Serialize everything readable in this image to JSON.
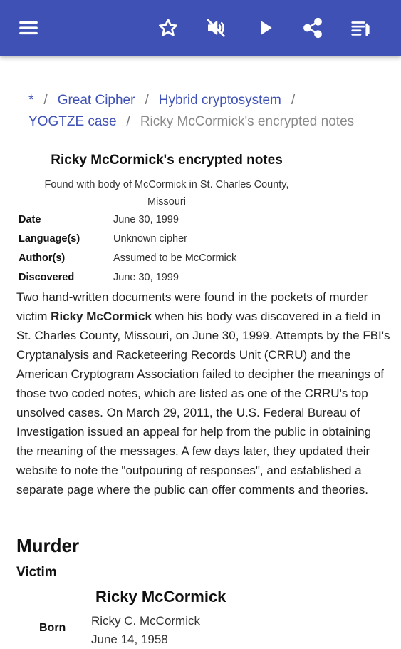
{
  "toolbar": {
    "menu_icon": "hamburger-menu-icon",
    "star_icon": "star-outline-icon",
    "mute_icon": "volume-off-icon",
    "play_icon": "play-icon",
    "share_icon": "share-icon",
    "toc_icon": "playlist-icon",
    "color": "#3f51b5"
  },
  "breadcrumb": {
    "items": [
      "*",
      "Great Cipher",
      "Hybrid cryptosystem",
      "YOGTZE case"
    ],
    "current": "Ricky McCormick's encrypted notes",
    "separator": "/"
  },
  "infobox": {
    "title": "Ricky McCormick's encrypted notes",
    "caption_line1": "Found with body of McCormick in St. Charles County,",
    "caption_line2": "Missouri",
    "rows": [
      {
        "key": "Date",
        "value": "June 30, 1999"
      },
      {
        "key": "Language(s)",
        "value": "Unknown cipher"
      },
      {
        "key": "Author(s)",
        "value": "Assumed to be McCormick"
      },
      {
        "key": "Discovered",
        "value": "June 30, 1999"
      }
    ]
  },
  "article": {
    "para_before": "Two hand-written documents were found in the pockets of murder victim ",
    "para_bold": "Ricky McCormick",
    "para_after": " when his body was discovered in a field in St. Charles County, Missouri, on June 30, 1999. Attempts by the FBI's Cryptanalysis and Racketeering Records Unit (CRRU) and the American Cryptogram Association failed to decipher the meanings of those two coded notes, which are listed as one of the CRRU's top unsolved cases. On March 29, 2011, the U.S. Federal Bureau of Investigation issued an appeal for help from the public in obtaining the meaning of the messages. A few days later, they updated their website to note the \"outpouring of responses\", and established a separate page where the public can offer comments and theories.",
    "heading_murder": "Murder",
    "heading_victim": "Victim",
    "victim_name": "Ricky McCormick",
    "born_label": "Born",
    "born_name": "Ricky C. McCormick",
    "born_date": "June 14, 1958"
  }
}
